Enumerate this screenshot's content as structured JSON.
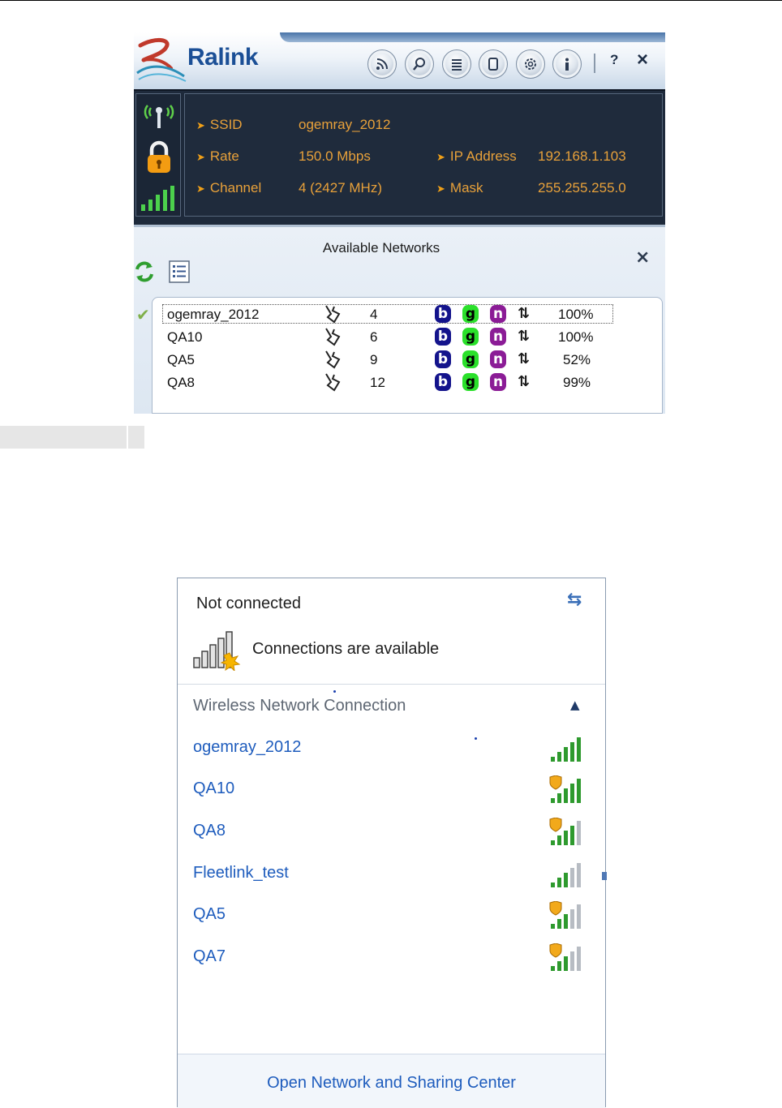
{
  "ralink": {
    "logo": "Ralink",
    "toolbar": {
      "help": "?",
      "close": "×",
      "icons": [
        "rss-icon",
        "search-icon",
        "list-icon",
        "page-icon",
        "gear-icon",
        "info-icon"
      ]
    },
    "status": {
      "ssid_label": "SSID",
      "ssid_value": "ogemray_2012",
      "rate_label": "Rate",
      "rate_value": "150.0 Mbps",
      "channel_label": "Channel",
      "channel_value": "4 (2427 MHz)",
      "ip_label": "IP Address",
      "ip_value": "192.168.1.103",
      "mask_label": "Mask",
      "mask_value": "255.255.255.0"
    },
    "available": {
      "title": "Available Networks",
      "close": "×",
      "networks": [
        {
          "ssid": "ogemray_2012",
          "channel": "4",
          "b": "b",
          "g": "g",
          "n": "n",
          "signal": "100%"
        },
        {
          "ssid": "QA10",
          "channel": "6",
          "b": "b",
          "g": "g",
          "n": "n",
          "signal": "100%"
        },
        {
          "ssid": "QA5",
          "channel": "9",
          "b": "b",
          "g": "g",
          "n": "n",
          "signal": "52%"
        },
        {
          "ssid": "QA8",
          "channel": "12",
          "b": "b",
          "g": "g",
          "n": "n",
          "signal": "99%"
        }
      ]
    },
    "colors": {
      "status_bg": "#1e2a3b",
      "status_text": "#e8a13a",
      "brand": "#1b4f96"
    }
  },
  "windows": {
    "title": "Not connected",
    "available_text": "Connections are available",
    "section": "Wireless Network Connection",
    "networks": [
      {
        "name": "ogemray_2012",
        "secured": false,
        "bars": 5
      },
      {
        "name": "QA10",
        "secured": true,
        "bars": 5
      },
      {
        "name": "QA8",
        "secured": true,
        "bars": 4
      },
      {
        "name": "Fleetlink_test",
        "secured": false,
        "bars": 3
      },
      {
        "name": "QA5",
        "secured": true,
        "bars": 3
      },
      {
        "name": "QA7",
        "secured": true,
        "bars": 3
      }
    ],
    "footer_link": "Open Network and Sharing Center",
    "colors": {
      "link": "#1e5cbd",
      "signal_on": "#2e9a2e",
      "signal_off": "#b7bcc3"
    }
  }
}
